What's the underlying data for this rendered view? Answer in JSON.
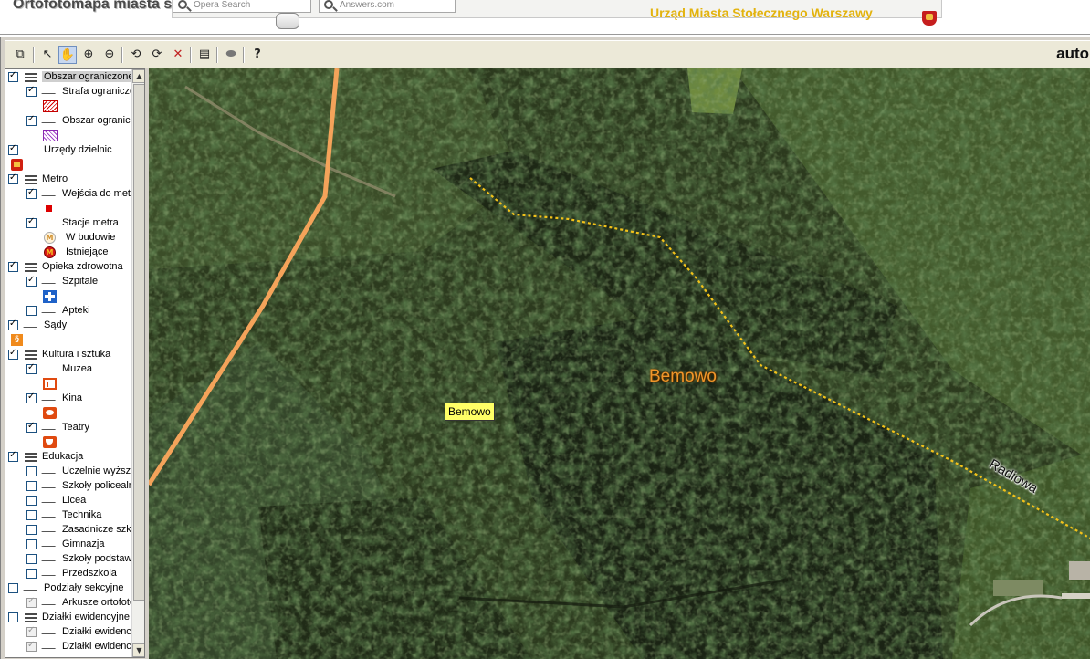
{
  "header": {
    "app_title": "Ortofotomapa miasta st. Warszawy",
    "search_opera": "Opera Search",
    "search_answers": "Answers.com",
    "office_name": "Urząd Miasta Stołecznego Warszawy"
  },
  "toolbar": {
    "buttons": [
      "copy",
      "select-arrow",
      "pan-hand",
      "zoom-in",
      "zoom-out",
      "zoom-prev",
      "zoom-next",
      "zoom-extent",
      "clear-selection",
      "print",
      "identify",
      "help"
    ],
    "auto_label": "auto"
  },
  "layers": [
    {
      "label": "Obszar ograniczonego",
      "checked": true,
      "kind": "group",
      "indent": 0,
      "highlighted": true
    },
    {
      "label": "Strafa ograniczonego",
      "checked": true,
      "kind": "line",
      "indent": 1
    },
    {
      "label": "Obszar ograniczonego",
      "checked": true,
      "kind": "line",
      "indent": 1
    },
    {
      "label": "Urzędy dzielnic",
      "checked": true,
      "kind": "line",
      "indent": 0
    },
    {
      "label": "Metro",
      "checked": true,
      "kind": "group",
      "indent": 0
    },
    {
      "label": "Wejścia do metra",
      "checked": true,
      "kind": "line",
      "indent": 1
    },
    {
      "label": "Stacje metra",
      "checked": true,
      "kind": "line",
      "indent": 1
    },
    {
      "label": "W budowie",
      "kind": "legend",
      "indent": 1
    },
    {
      "label": "Istniejące",
      "kind": "legend",
      "indent": 1
    },
    {
      "label": "Opieka zdrowotna",
      "checked": true,
      "kind": "group",
      "indent": 0
    },
    {
      "label": "Szpitale",
      "checked": true,
      "kind": "line",
      "indent": 1
    },
    {
      "label": "Apteki",
      "checked": false,
      "kind": "line",
      "indent": 1
    },
    {
      "label": "Sądy",
      "checked": true,
      "kind": "line",
      "indent": 0
    },
    {
      "label": "Kultura i sztuka",
      "checked": true,
      "kind": "group",
      "indent": 0
    },
    {
      "label": "Muzea",
      "checked": true,
      "kind": "line",
      "indent": 1
    },
    {
      "label": "Kina",
      "checked": true,
      "kind": "line",
      "indent": 1
    },
    {
      "label": "Teatry",
      "checked": true,
      "kind": "line",
      "indent": 1
    },
    {
      "label": "Edukacja",
      "checked": true,
      "kind": "group",
      "indent": 0
    },
    {
      "label": "Uczelnie wyższe",
      "checked": false,
      "kind": "line",
      "indent": 1
    },
    {
      "label": "Szkoły policealne",
      "checked": false,
      "kind": "line",
      "indent": 1
    },
    {
      "label": "Licea",
      "checked": false,
      "kind": "line",
      "indent": 1
    },
    {
      "label": "Technika",
      "checked": false,
      "kind": "line",
      "indent": 1
    },
    {
      "label": "Zasadnicze szkoły",
      "checked": false,
      "kind": "line",
      "indent": 1
    },
    {
      "label": "Gimnazja",
      "checked": false,
      "kind": "line",
      "indent": 1
    },
    {
      "label": "Szkoły podstawowe",
      "checked": false,
      "kind": "line",
      "indent": 1
    },
    {
      "label": "Przedszkola",
      "checked": false,
      "kind": "line",
      "indent": 1
    },
    {
      "label": "Podziały sekcyjne",
      "checked": false,
      "kind": "line",
      "indent": 0
    },
    {
      "label": "Arkusze ortofotomapy",
      "checked": "disabled",
      "kind": "line",
      "indent": 1
    },
    {
      "label": "Działki ewidencyjne",
      "checked": false,
      "kind": "group",
      "indent": 0
    },
    {
      "label": "Działki ewidencyjne",
      "checked": "disabled",
      "kind": "line",
      "indent": 1
    },
    {
      "label": "Działki ewidencyjne",
      "checked": "disabled",
      "kind": "line",
      "indent": 1
    }
  ],
  "map": {
    "label_box": "Bemowo",
    "district_label": "Bemowo",
    "street_label": "Radiowa",
    "colors": {
      "boundary": "#f4a35a",
      "street_dash": "#f2c21a",
      "district_text": "#f0962a",
      "label_bg": "#ffff66"
    }
  }
}
